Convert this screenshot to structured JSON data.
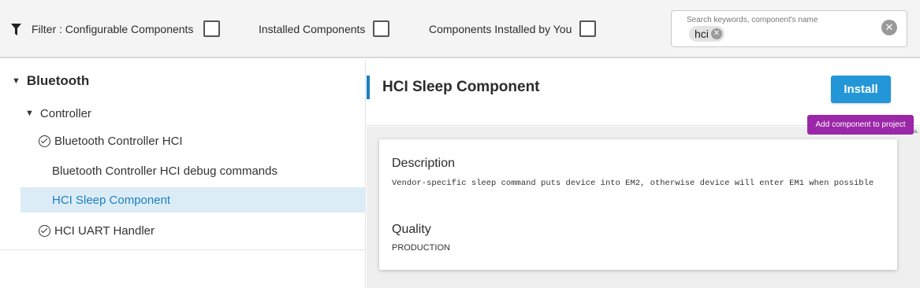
{
  "filter": {
    "prefix": "Filter :",
    "options": [
      {
        "label": "Configurable Components",
        "checked": false
      },
      {
        "label": "Installed Components",
        "checked": false
      },
      {
        "label": "Components Installed by You",
        "checked": false
      }
    ]
  },
  "search": {
    "placeholder": "Search keywords, component's name",
    "chip": "hci",
    "clear_icon": "clear-circle-icon"
  },
  "tree": {
    "root": "Bluetooth",
    "controller": "Controller",
    "items": [
      {
        "label": "Bluetooth Controller HCI",
        "installed": true
      },
      {
        "label": "Bluetooth Controller HCI debug commands",
        "installed": false
      },
      {
        "label": "HCI Sleep Component",
        "installed": false,
        "selected": true
      },
      {
        "label": "HCI UART Handler",
        "installed": true
      }
    ]
  },
  "detail": {
    "title": "HCI Sleep Component",
    "install_label": "Install",
    "tooltip": "Add component to project",
    "description_heading": "Description",
    "description": "Vendor-specific sleep command puts device into EM2, otherwise device will enter EM1 when possible",
    "quality_heading": "Quality",
    "quality": "PRODUCTION"
  },
  "colors": {
    "accent": "#1a7fc0",
    "install_button": "#2396d8",
    "tooltip": "#9b27a8",
    "selected_row": "#dcecf6"
  }
}
